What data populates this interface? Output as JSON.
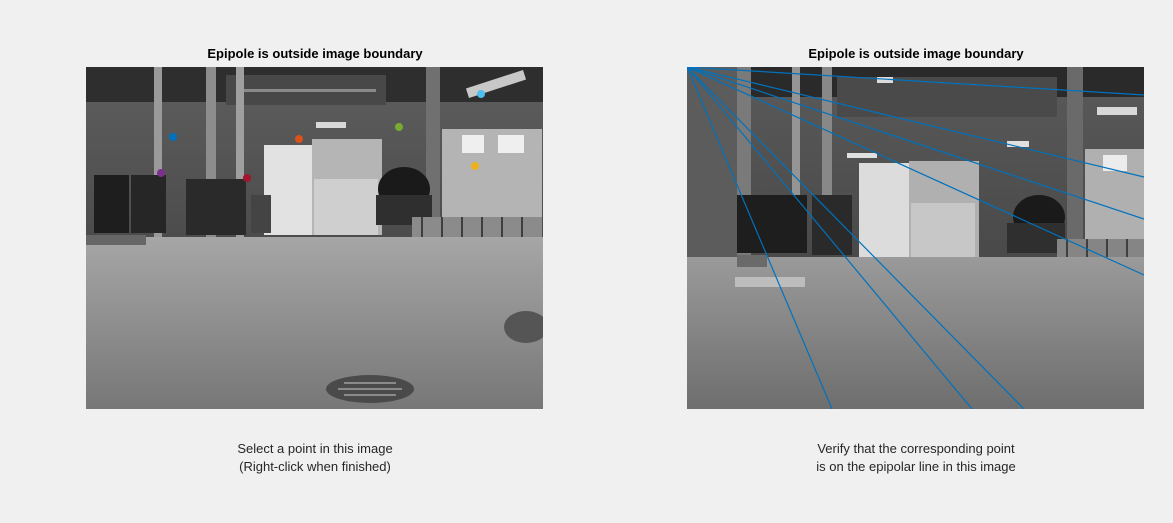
{
  "left_panel": {
    "title": "Epipole is outside image boundary",
    "caption_line1": "Select a point in this image",
    "caption_line2": "(Right-click when finished)",
    "markers": [
      {
        "name": "blue-point",
        "color": "#0072bd"
      },
      {
        "name": "orange-point",
        "color": "#d95319"
      },
      {
        "name": "yellow-point",
        "color": "#edb120"
      },
      {
        "name": "purple-point",
        "color": "#7e2f8e"
      },
      {
        "name": "green-point",
        "color": "#77ac30"
      },
      {
        "name": "cyan-point",
        "color": "#4dbeee"
      },
      {
        "name": "red-point",
        "color": "#a2142f"
      }
    ]
  },
  "right_panel": {
    "title": "Epipole is outside image boundary",
    "caption_line1": "Verify that the corresponding point",
    "caption_line2": "is on the epipolar line in this image",
    "epipolar_line_color": "#0072bd",
    "epipolar_line_count": 7
  }
}
